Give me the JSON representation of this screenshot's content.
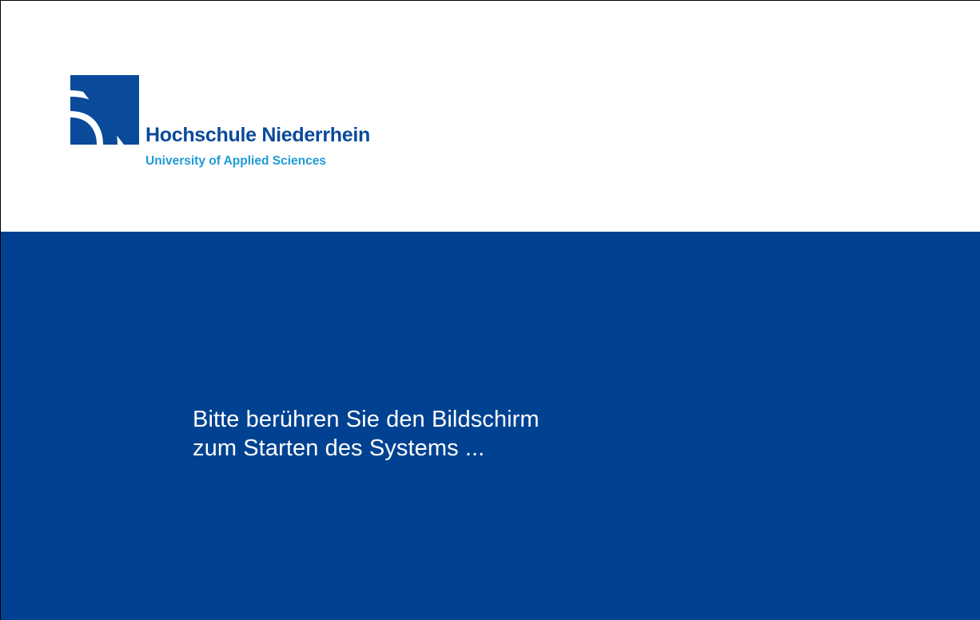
{
  "header": {
    "logo_icon": "hochschule-niederrhein-logo",
    "brand_name": "Hochschule Niederrhein",
    "brand_subtitle": "University of Applied Sciences"
  },
  "main": {
    "prompt_line1": "Bitte berühren Sie den Bildschirm",
    "prompt_line2": "zum Starten des Systems ..."
  },
  "colors": {
    "brand_blue": "#004291",
    "logo_blue": "#0a4a9a",
    "subtitle_cyan": "#1f9ad6",
    "background": "#ffffff"
  }
}
